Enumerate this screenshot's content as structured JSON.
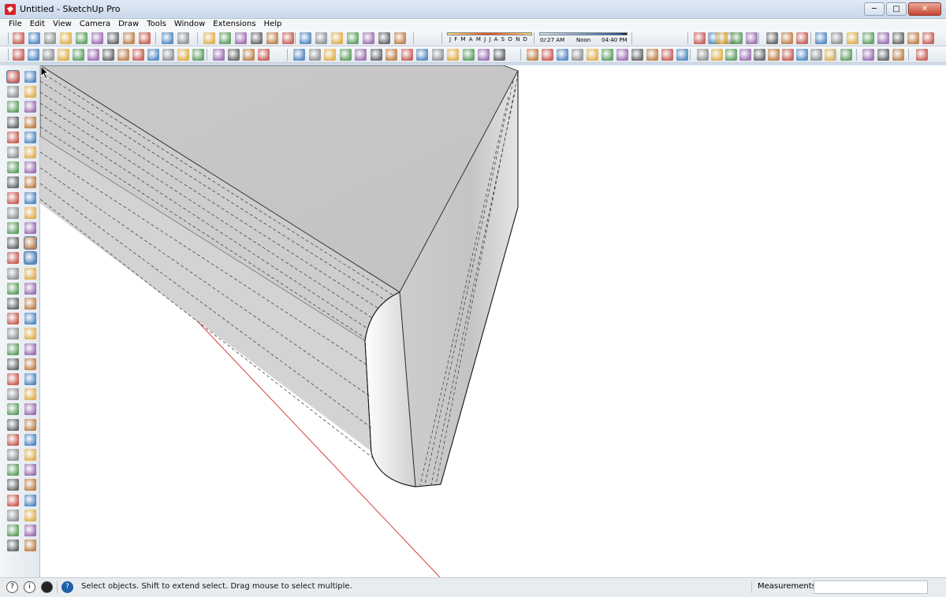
{
  "window": {
    "title": "Untitled - SketchUp Pro",
    "minimize_label": "─",
    "maximize_label": "□",
    "close_label": "✕"
  },
  "menu": [
    "File",
    "Edit",
    "View",
    "Camera",
    "Draw",
    "Tools",
    "Window",
    "Extensions",
    "Help"
  ],
  "shadow_settings": {
    "months": "J F M A M J J A S O N D",
    "time_start": "0/:27 AM",
    "time_noon": "Noon",
    "time_end": "04:40 PM"
  },
  "status": {
    "message": "Select objects. Shift to extend select. Drag mouse to select multiple.",
    "measurements_label": "Measurements",
    "measurements_value": ""
  },
  "status_icons": [
    "geolocation-icon",
    "credits-icon",
    "user-icon",
    "help-icon"
  ],
  "colors": {
    "canvas": "#ffffff",
    "red_axis": "#d64040",
    "accent": "#3a5f8f"
  }
}
